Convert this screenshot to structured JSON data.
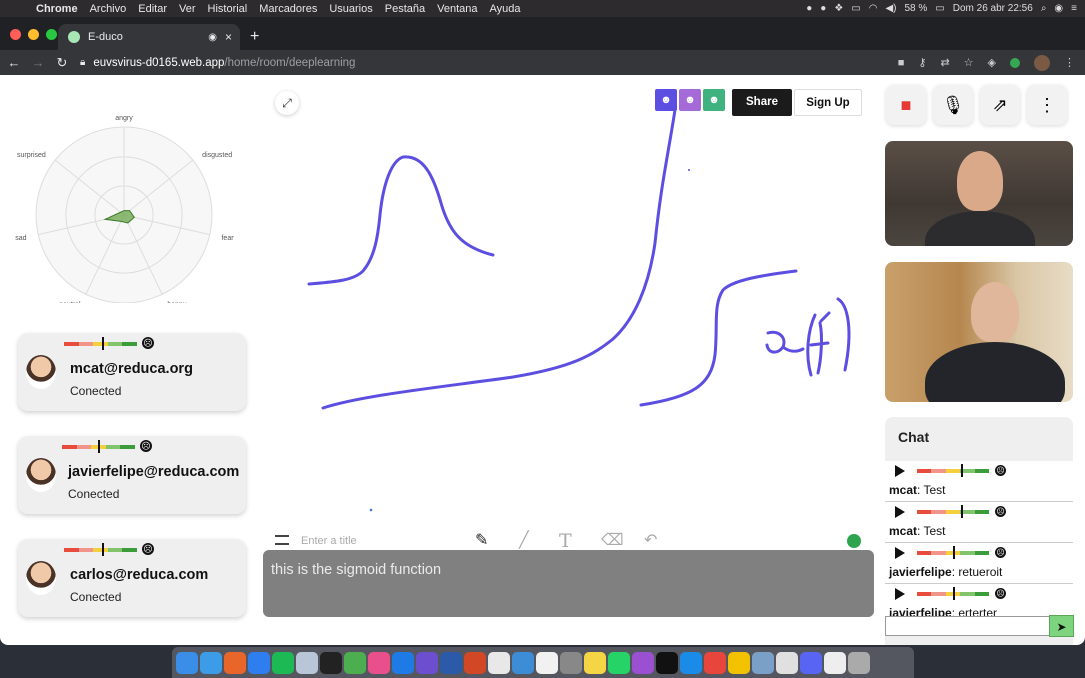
{
  "menubar": {
    "app": "Chrome",
    "items": [
      "Archivo",
      "Editar",
      "Ver",
      "Historial",
      "Marcadores",
      "Usuarios",
      "Pestaña",
      "Ventana",
      "Ayuda"
    ],
    "battery": "58 %",
    "datetime": "Dom 26 abr 22:56"
  },
  "browser": {
    "tab_title": "E-duco",
    "url_host": "euvsvirus-d0165.web.app",
    "url_path": "/home/room/deeplearning"
  },
  "radar": {
    "labels": [
      "angry",
      "disgusted",
      "fearful",
      "happy",
      "neutral",
      "sad",
      "surprised"
    ],
    "values": [
      0.05,
      0.08,
      0.12,
      0.1,
      0.08,
      0.22,
      0.05
    ],
    "fill_color": "#6aa64a"
  },
  "users": [
    {
      "email": "mcat@reduca.org",
      "status": "Conected",
      "meter": 0.5
    },
    {
      "email": "javierfelipe@reduca.com",
      "status": "Conected",
      "meter": 0.5
    },
    {
      "email": "carlos@reduca.com",
      "status": "Conected",
      "meter": 0.5
    }
  ],
  "board": {
    "share_label": "Share",
    "signup_label": "Sign Up",
    "title_placeholder": "Enter a title",
    "caption": "this is the sigmoid function",
    "stroke_color": "#5b4ee0"
  },
  "chat": {
    "title": "Chat",
    "messages": [
      {
        "user": "mcat",
        "text": ": Test",
        "meter": 0.62
      },
      {
        "user": "mcat",
        "text": ": Test",
        "meter": 0.62
      },
      {
        "user": "javierfelipe",
        "text": ": retueroit",
        "meter": 0.5
      },
      {
        "user": "javierfelipe",
        "text": ": erterter",
        "meter": 0.5
      }
    ]
  }
}
